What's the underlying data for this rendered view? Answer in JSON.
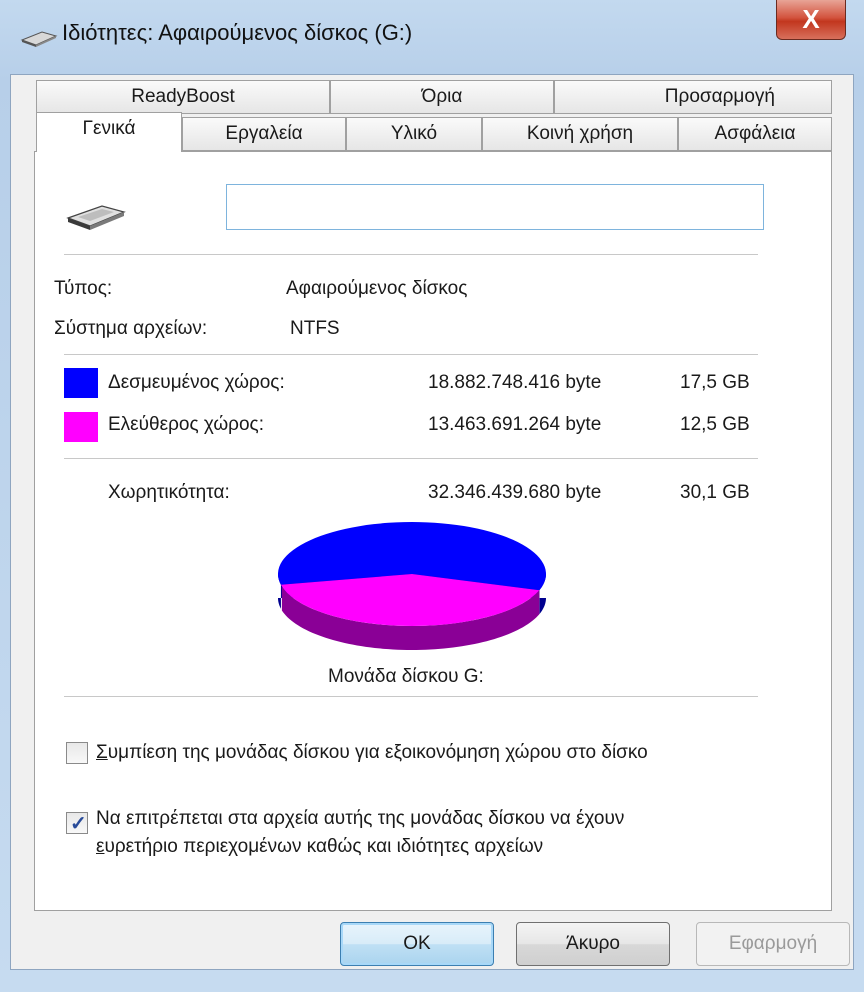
{
  "window": {
    "title": "Ιδιότητες: Αφαιρούμενος δίσκος (G:)",
    "close_glyph": "X"
  },
  "tabs_row1": [
    {
      "label": "ReadyBoost"
    },
    {
      "label": "Όρια"
    },
    {
      "label": "Προσαρμογή"
    }
  ],
  "tabs_row2": [
    {
      "label": "Γενικά",
      "active": true
    },
    {
      "label": "Εργαλεία"
    },
    {
      "label": "Υλικό"
    },
    {
      "label": "Κοινή χρήση"
    },
    {
      "label": "Ασφάλεια"
    }
  ],
  "general": {
    "drive_name_value": "",
    "type_label": "Τύπος:",
    "type_value": "Αφαιρούμενος δίσκος",
    "fs_label": "Σύστημα αρχείων:",
    "fs_value": "NTFS",
    "used": {
      "label": "Δεσμευμένος χώρος:",
      "bytes": "18.882.748.416 byte",
      "gb": "17,5 GB",
      "color": "#0000ff"
    },
    "free": {
      "label": "Ελεύθερος χώρος:",
      "bytes": "13.463.691.264 byte",
      "gb": "12,5 GB",
      "color": "#ff00ff"
    },
    "capacity": {
      "label": "Χωρητικότητα:",
      "bytes": "32.346.439.680 byte",
      "gb": "30,1 GB"
    },
    "drive_caption": "Μονάδα δίσκου G:"
  },
  "chart_data": {
    "type": "pie",
    "values": [
      18882748416,
      13463691264
    ],
    "colors": [
      "#0000ff",
      "#ff00ff"
    ]
  },
  "options": {
    "compress": {
      "underline_char": "Σ",
      "label_rest": "υμπίεση της μονάδας δίσκου για εξοικονόμηση χώρου στο δίσκο",
      "checked": false
    },
    "index": {
      "line1": "Να επιτρέπεται στα αρχεία αυτής της μονάδας δίσκου να έχουν",
      "underline_char": "ε",
      "line2_rest": "υρετήριο περιεχομένων καθώς και ιδιότητες αρχείων",
      "checked": true
    }
  },
  "buttons": {
    "ok": "OK",
    "cancel": "Άκυρο",
    "apply": "Εφαρμογή"
  }
}
